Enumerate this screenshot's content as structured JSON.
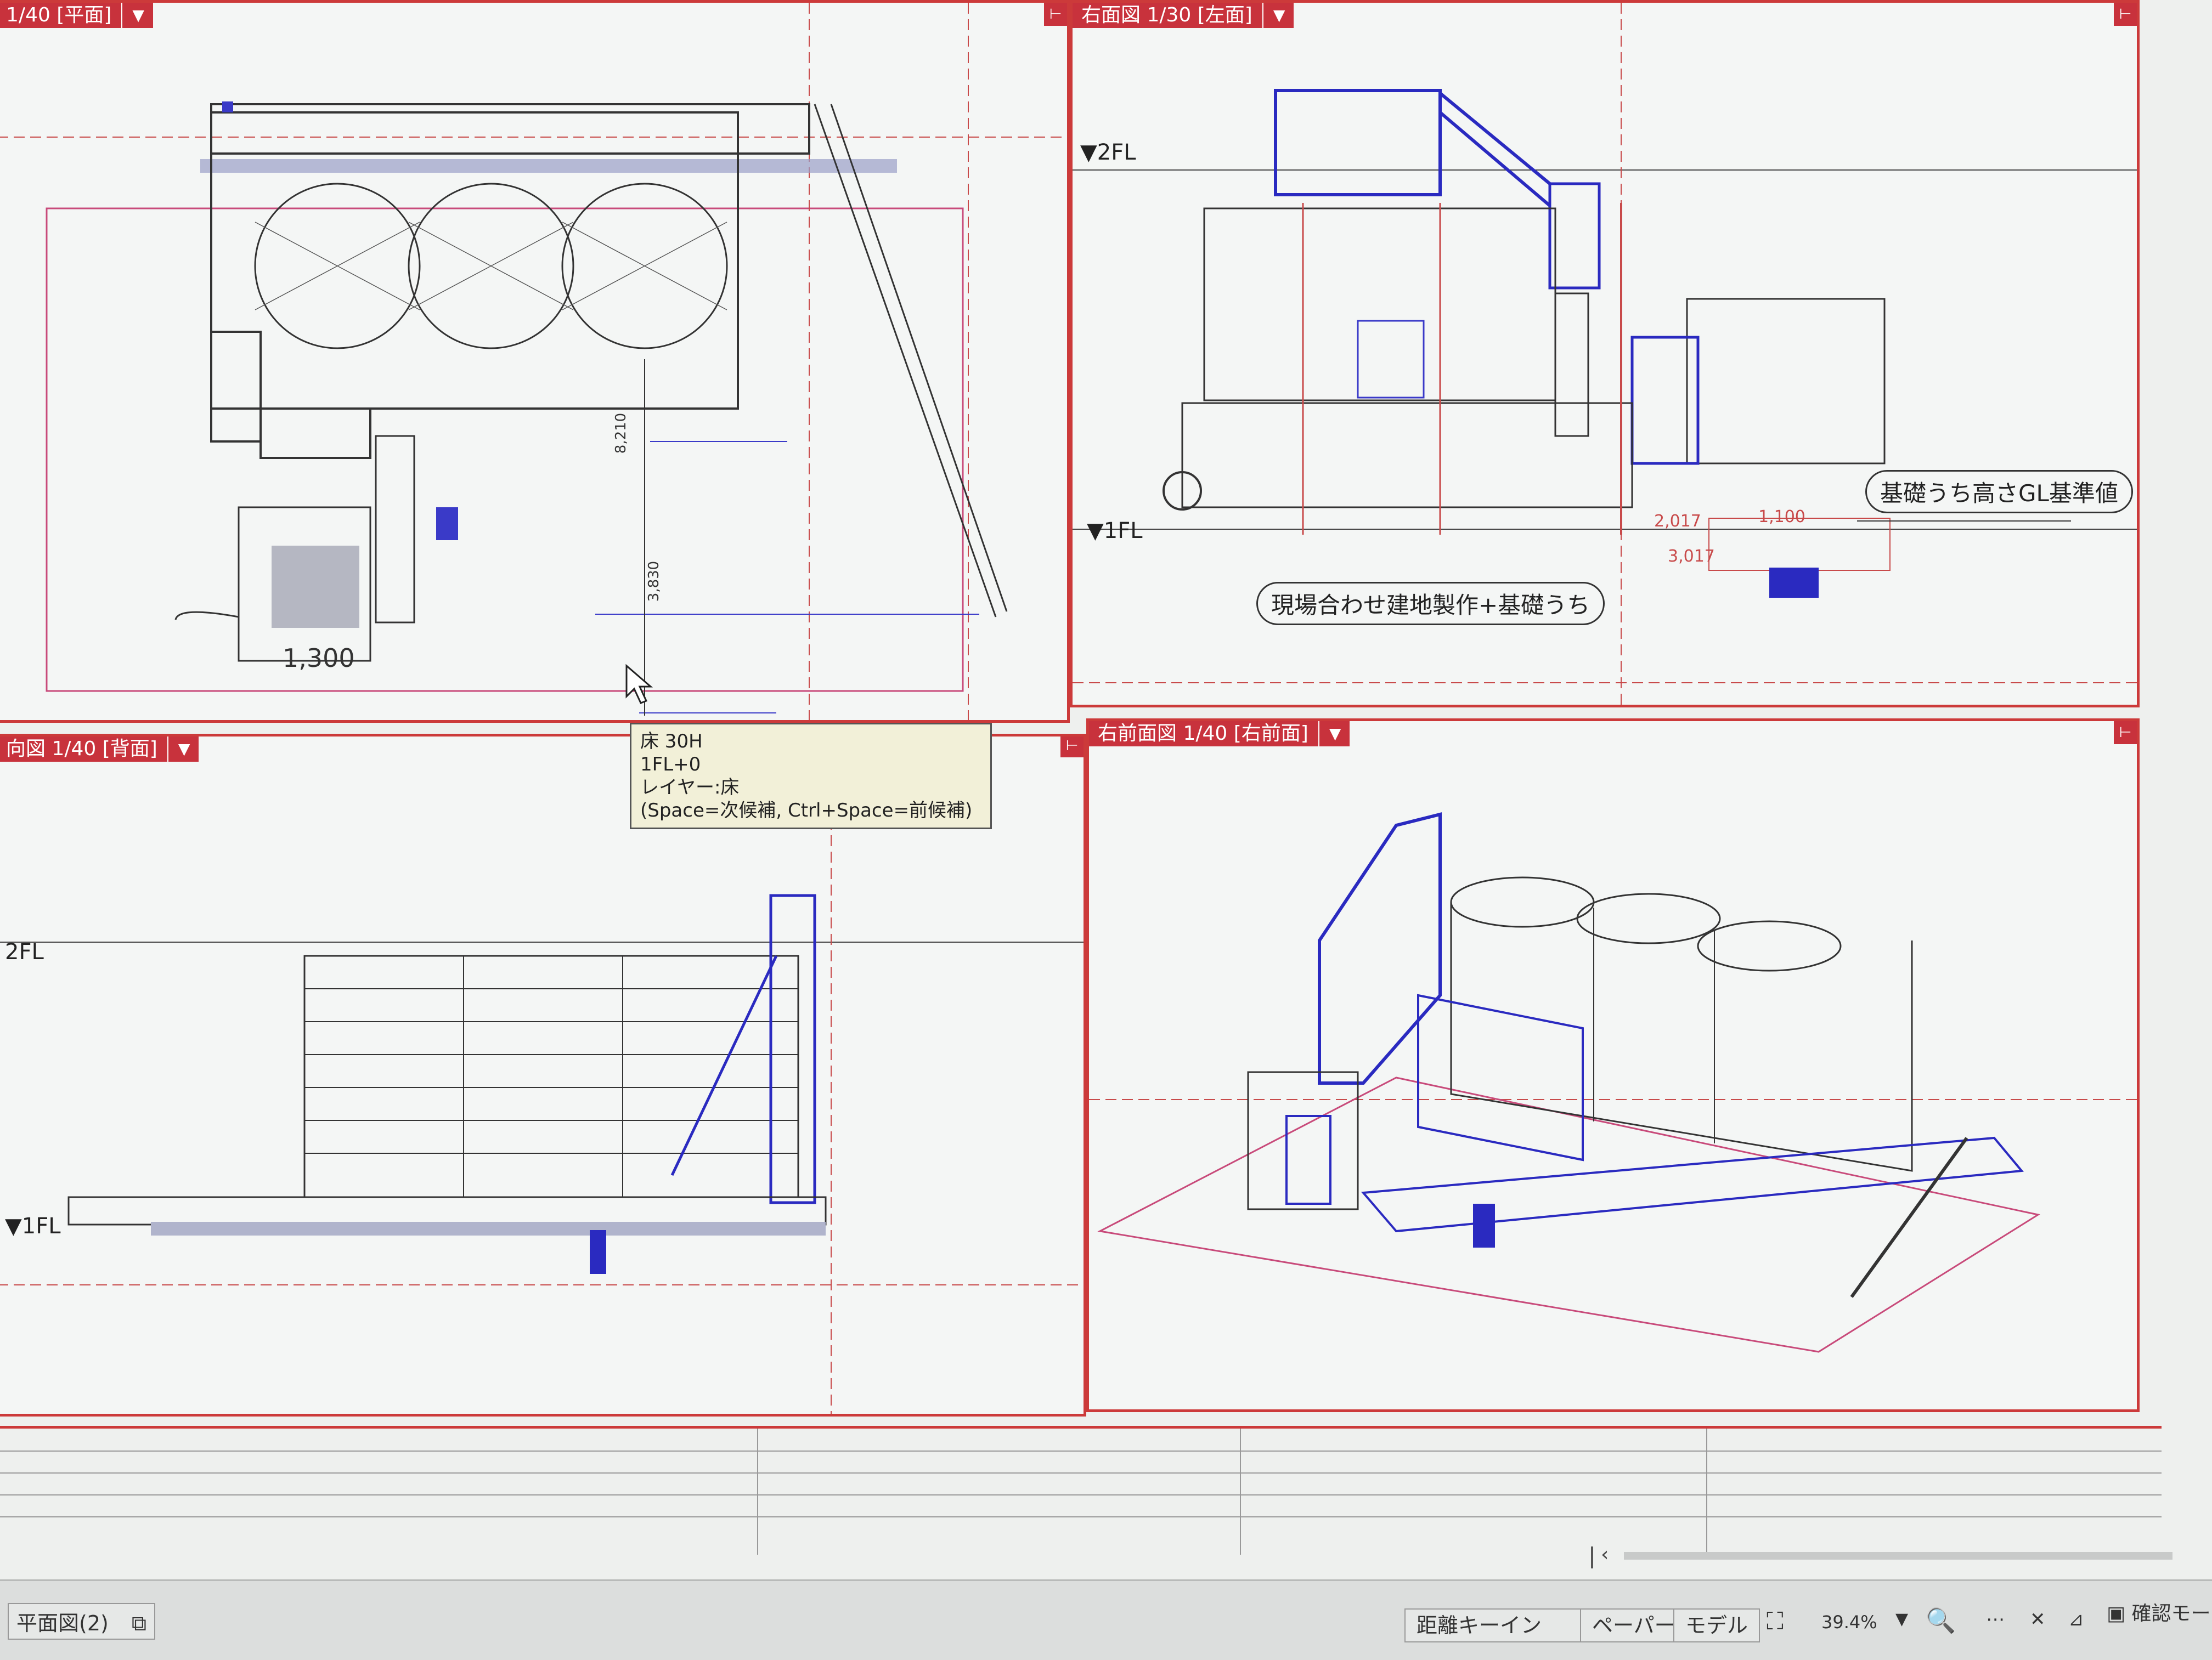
{
  "viewports": {
    "plan": {
      "title": "1/40 [平面]",
      "dim_label": "1,300",
      "dims": [
        "8,210",
        "3,830",
        "1,300"
      ]
    },
    "left": {
      "title": "右面図 1/30 [左面]",
      "level_2fl": "▼2FL",
      "level_1fl": "▼1FL",
      "callout_foundation": "基礎うち高さGL基準値",
      "callout_site": "現場合わせ建地製作+基礎うち",
      "dims": [
        "2,017",
        "1,100",
        "3,017"
      ]
    },
    "back": {
      "title": "向図 1/40 [背面]",
      "level_2fl": "2FL",
      "level_1fl": "▼1FL"
    },
    "iso": {
      "title": "右前面図 1/40 [右前面]"
    }
  },
  "tooltip": {
    "line1": "床 30H",
    "line2": "1FL+0",
    "line3": "レイヤー:床",
    "line4": "(Space=次候補, Ctrl+Space=前候補)"
  },
  "statusbar": {
    "sheet_tab": "平面図(2)",
    "distance_key_in": "距離キーイン",
    "paper": "ペーパー",
    "model": "モデル",
    "zoom": "39.4%",
    "confirm_mode": "確認モー"
  },
  "icons": {
    "pin": "pin-icon",
    "caret": "dropdown-caret-icon",
    "cursor": "mouse-cursor-icon",
    "zoom": "magnifier-icon"
  }
}
